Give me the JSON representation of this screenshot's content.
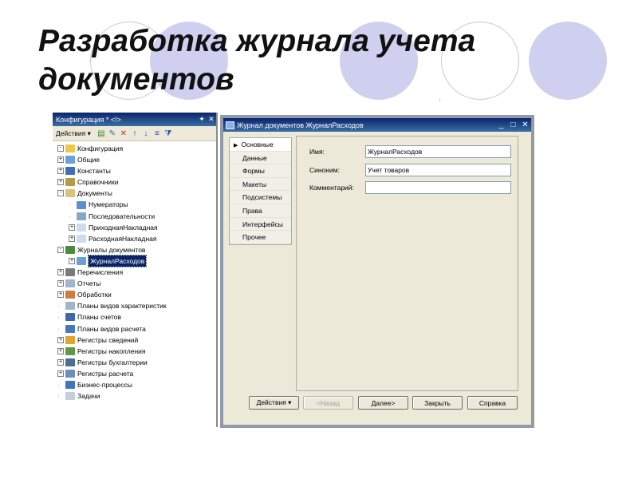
{
  "slide": {
    "title_line1": "Разработка журнала учета",
    "title_line2": "документов"
  },
  "config_panel": {
    "title": "Конфигурация * <!>",
    "pin_icon": "pin-icon",
    "close_icon": "close-icon",
    "toolbar": {
      "actions_label": "Действия ▾",
      "icons": [
        "add-icon",
        "edit-icon",
        "delete-icon",
        "move-up-icon",
        "move-down-icon",
        "sort-icon",
        "filter-icon"
      ]
    },
    "tree": [
      {
        "label": "Конфигурация",
        "expander": "-",
        "icon_color": "#f2c64a",
        "indent": 0
      },
      {
        "label": "Общие",
        "expander": "+",
        "icon_color": "#6aa1d8",
        "indent": 0
      },
      {
        "label": "Константы",
        "expander": "+",
        "icon_color": "#3e6fb8",
        "indent": 0
      },
      {
        "label": "Справочники",
        "expander": "+",
        "icon_color": "#b79a46",
        "indent": 0
      },
      {
        "label": "Документы",
        "expander": "-",
        "icon_color": "#d9c37a",
        "indent": 0
      },
      {
        "label": "Нумераторы",
        "expander": "",
        "icon_color": "#5e8dd0",
        "indent": 1
      },
      {
        "label": "Последовательности",
        "expander": "",
        "icon_color": "#8aa6c6",
        "indent": 1
      },
      {
        "label": "ПриходнаяНакладная",
        "expander": "+",
        "icon_color": "#cfdcef",
        "indent": 1
      },
      {
        "label": "РасходнаяНакладная",
        "expander": "+",
        "icon_color": "#cfdcef",
        "indent": 1
      },
      {
        "label": "Журналы документов",
        "expander": "-",
        "icon_color": "#4d8a3c",
        "indent": 0
      },
      {
        "label": "ЖурналРасходов",
        "expander": "+",
        "icon_color": "#6a9fd8",
        "indent": 1,
        "selected": true
      },
      {
        "label": "Перечисления",
        "expander": "+",
        "icon_color": "#7a7a7a",
        "indent": 0
      },
      {
        "label": "Отчеты",
        "expander": "+",
        "icon_color": "#9fb5d0",
        "indent": 0
      },
      {
        "label": "Обработки",
        "expander": "+",
        "icon_color": "#d07c3c",
        "indent": 0
      },
      {
        "label": "Планы видов характеристик",
        "expander": "",
        "icon_color": "#a2b4c8",
        "indent": 0
      },
      {
        "label": "Планы счетов",
        "expander": "",
        "icon_color": "#3f68a8",
        "indent": 0
      },
      {
        "label": "Планы видов расчета",
        "expander": "",
        "icon_color": "#4a78c0",
        "indent": 0
      },
      {
        "label": "Регистры сведений",
        "expander": "+",
        "icon_color": "#e0a632",
        "indent": 0
      },
      {
        "label": "Регистры накопления",
        "expander": "+",
        "icon_color": "#5f9a43",
        "indent": 0
      },
      {
        "label": "Регистры бухгалтерии",
        "expander": "+",
        "icon_color": "#4a6f98",
        "indent": 0
      },
      {
        "label": "Регистры расчета",
        "expander": "+",
        "icon_color": "#6d8fbf",
        "indent": 0
      },
      {
        "label": "Бизнес-процессы",
        "expander": "",
        "icon_color": "#3e76b8",
        "indent": 0
      },
      {
        "label": "Задачи",
        "expander": "",
        "icon_color": "#c8ced8",
        "indent": 0
      }
    ]
  },
  "form": {
    "title": "Журнал документов ЖурналРасходов",
    "window_buttons": [
      "minimize-icon",
      "maximize-icon",
      "close-icon"
    ],
    "nav": [
      "Основные",
      "Данные",
      "Формы",
      "Макеты",
      "Подсистемы",
      "Права",
      "Интерфейсы",
      "Прочее"
    ],
    "fields": {
      "name_label": "Имя:",
      "name_value": "ЖурналРасходов",
      "synonym_label": "Синоним:",
      "synonym_value": "Учет товаров",
      "comment_label": "Комментарий:",
      "comment_value": ""
    },
    "buttons": {
      "actions": "Действия ▾",
      "back": "<Назад",
      "next": "Далее>",
      "close": "Закрыть",
      "help": "Справка"
    }
  },
  "colors": {
    "deco_circle": "#cfd0f0",
    "deco_ring": "#c6c7e6",
    "titlebar_start": "#0a246a",
    "titlebar_end": "#3a6ea5",
    "dialog_bg": "#ece9d8"
  }
}
